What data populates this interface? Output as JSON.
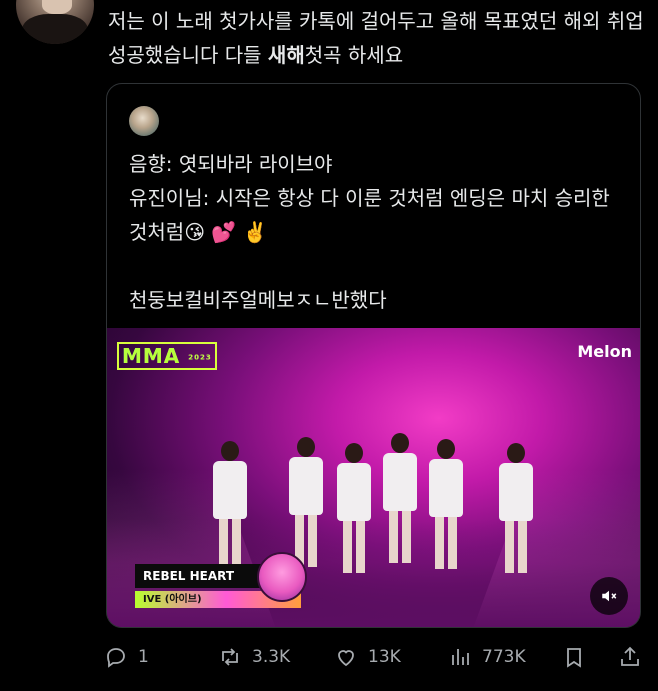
{
  "tweet": {
    "text_before_bold": "저는 이 노래 첫가사를 카톡에 걸어두고 올해 목표였던 해외 취업 성공했습니다 다들 ",
    "text_bold": "새해",
    "text_after_bold": "첫곡 하세요"
  },
  "quote": {
    "text": "음향: 엿되바라 라이브야\n유진이님: 시작은 항상 다 이룬 것처럼 엔딩은 마치 승리한 것처럼😘 💕 ✌️\n\n천둥보컬비주얼메보ㅈㄴ반했다",
    "media": {
      "brand_left": "MMA",
      "brand_left_year": "2023",
      "brand_right": "Melon",
      "song_title": "REBEL HEART",
      "song_artist": "IVE (아이브)",
      "mute_icon_label": "🔇"
    }
  },
  "actions": {
    "reply_count": "1",
    "repost_count": "3.3K",
    "like_count": "13K",
    "views_count": "773K"
  },
  "colors": {
    "background": "#000000",
    "text": "#e7e9ea",
    "muted": "#71767b",
    "border": "#2f3336"
  }
}
